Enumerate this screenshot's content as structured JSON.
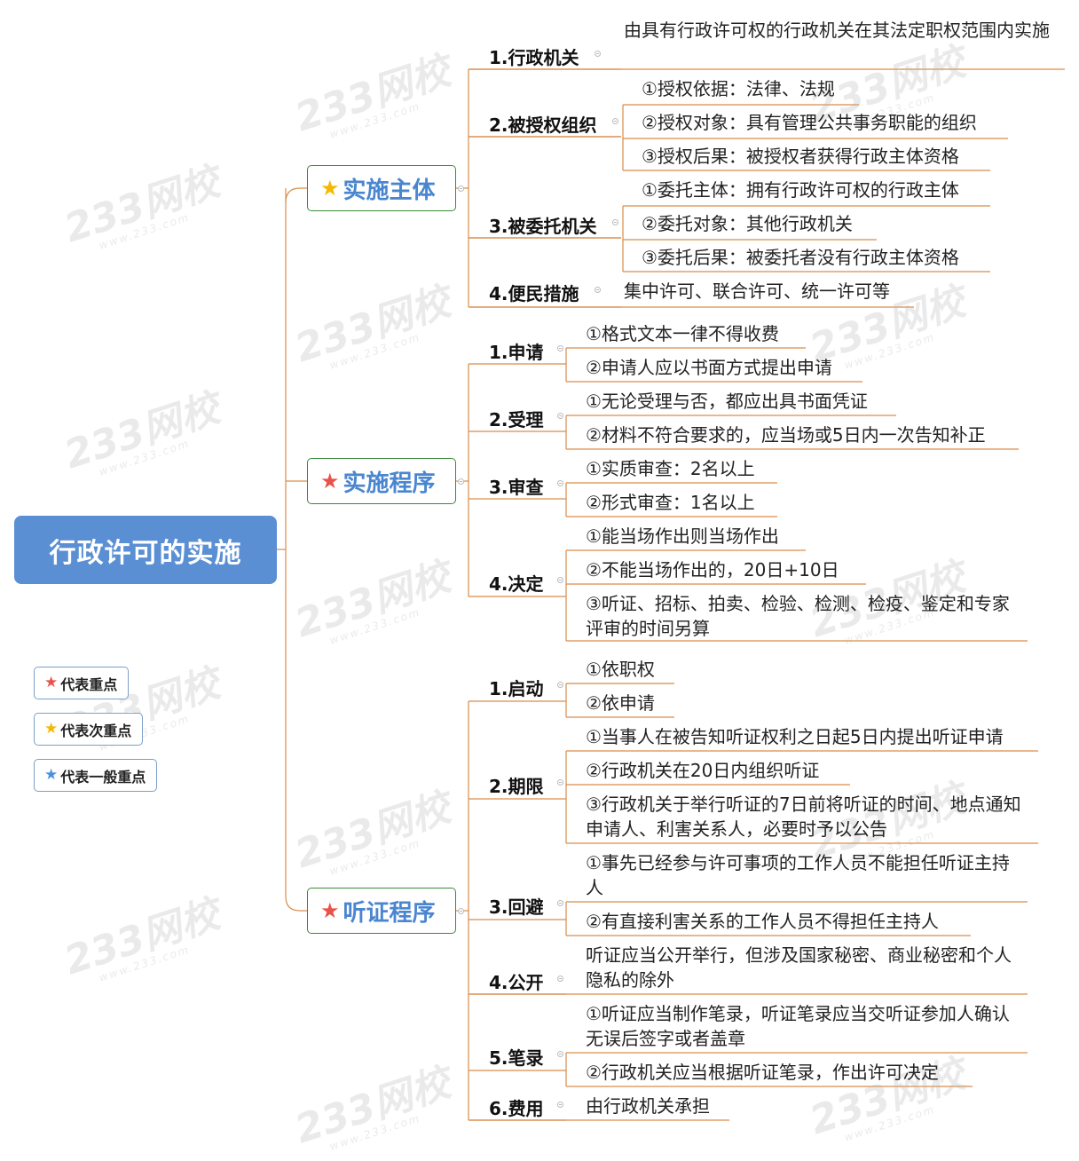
{
  "root": {
    "title": "行政许可的实施"
  },
  "colors": {
    "root_bg": "#5b8fd4",
    "line": "#d98c4a",
    "red_star": "#e8524a",
    "yellow_star": "#f5b800",
    "blue_star": "#4a90e2",
    "main_text": "#4a86d0",
    "main_border": "#3a8a3a"
  },
  "branches": [
    {
      "label": "实施主体",
      "star": "yellow",
      "children": [
        {
          "label": "1.行政机关",
          "leaves": [
            "由具有行政许可权的行政机关在其法定职权范围内实施"
          ]
        },
        {
          "label": "2.被授权组织",
          "leaves": [
            "①授权依据：法律、法规",
            "②授权对象：具有管理公共事务职能的组织",
            "③授权后果：被授权者获得行政主体资格"
          ]
        },
        {
          "label": "3.被委托机关",
          "leaves": [
            "①委托主体：拥有行政许可权的行政主体",
            "②委托对象：其他行政机关",
            "③委托后果：被委托者没有行政主体资格"
          ]
        },
        {
          "label": "4.便民措施",
          "leaves": [
            "集中许可、联合许可、统一许可等"
          ]
        }
      ]
    },
    {
      "label": "实施程序",
      "star": "red",
      "children": [
        {
          "label": "1.申请",
          "leaves": [
            "①格式文本一律不得收费",
            "②申请人应以书面方式提出申请"
          ]
        },
        {
          "label": "2.受理",
          "leaves": [
            "①无论受理与否，都应出具书面凭证",
            "②材料不符合要求的，应当场或5日内一次告知补正"
          ]
        },
        {
          "label": "3.审查",
          "leaves": [
            "①实质审查：2名以上",
            "②形式审查：1名以上"
          ]
        },
        {
          "label": "4.决定",
          "leaves": [
            "①能当场作出则当场作出",
            "②不能当场作出的，20日+10日",
            "③听证、招标、拍卖、检验、检测、检疫、鉴定和专家评审的时间另算"
          ]
        }
      ]
    },
    {
      "label": "听证程序",
      "star": "red",
      "children": [
        {
          "label": "1.启动",
          "leaves": [
            "①依职权",
            "②依申请"
          ]
        },
        {
          "label": "2.期限",
          "leaves": [
            "①当事人在被告知听证权利之日起5日内提出听证申请",
            "②行政机关在20日内组织听证",
            "③行政机关于举行听证的7日前将听证的时间、地点通知申请人、利害关系人，必要时予以公告"
          ]
        },
        {
          "label": "3.回避",
          "leaves": [
            "①事先已经参与许可事项的工作人员不能担任听证主持人",
            "②有直接利害关系的工作人员不得担任主持人"
          ]
        },
        {
          "label": "4.公开",
          "leaves": [
            "听证应当公开举行，但涉及国家秘密、商业秘密和个人隐私的除外"
          ]
        },
        {
          "label": "5.笔录",
          "leaves": [
            "①听证应当制作笔录，听证笔录应当交听证参加人确认无误后签字或者盖章",
            "②行政机关应当根据听证笔录，作出许可决定"
          ]
        },
        {
          "label": "6.费用",
          "leaves": [
            "由行政机关承担"
          ]
        }
      ]
    }
  ],
  "legend": [
    {
      "label": "代表重点",
      "star": "red"
    },
    {
      "label": "代表次重点",
      "star": "yellow"
    },
    {
      "label": "代表一般重点",
      "star": "blue"
    }
  ],
  "watermark": {
    "text": "233网校",
    "sub": "www.233.com"
  }
}
